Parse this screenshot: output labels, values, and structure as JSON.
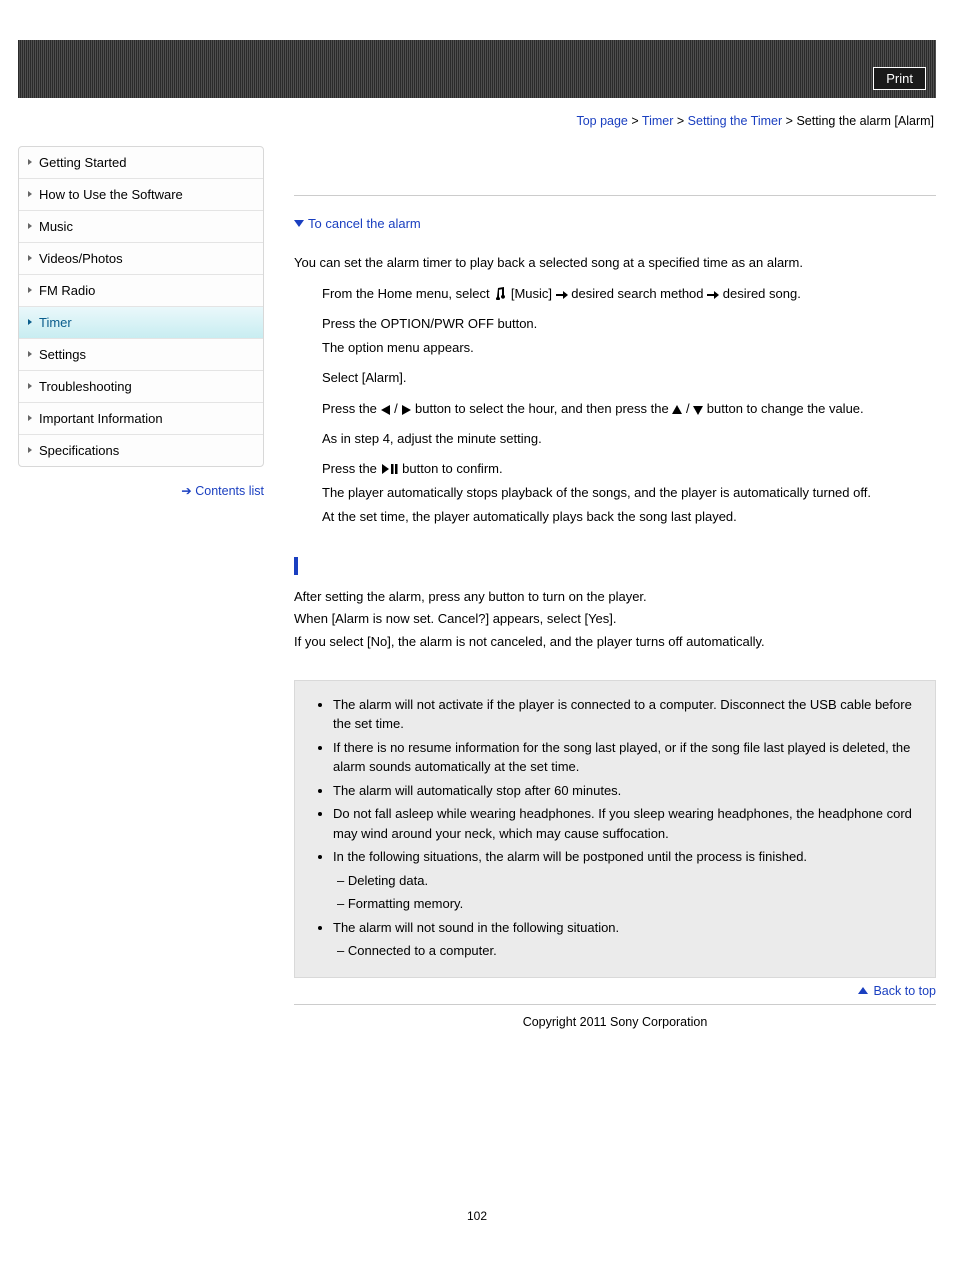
{
  "header": {
    "print_label": "Print"
  },
  "breadcrumbs": {
    "items": [
      "Top page",
      "Timer",
      "Setting the Timer"
    ],
    "current": "Setting the alarm [Alarm]",
    "sep": " > "
  },
  "sidebar": {
    "items": [
      {
        "label": "Getting Started",
        "active": false
      },
      {
        "label": "How to Use the Software",
        "active": false
      },
      {
        "label": "Music",
        "active": false
      },
      {
        "label": "Videos/Photos",
        "active": false
      },
      {
        "label": "FM Radio",
        "active": false
      },
      {
        "label": "Timer",
        "active": true
      },
      {
        "label": "Settings",
        "active": false
      },
      {
        "label": "Troubleshooting",
        "active": false
      },
      {
        "label": "Important Information",
        "active": false
      },
      {
        "label": "Specifications",
        "active": false
      }
    ],
    "contents_list": "Contents list"
  },
  "main": {
    "jump": "To cancel the alarm",
    "intro": "You can set the alarm timer to play back a selected song at a specified time as an alarm.",
    "steps": {
      "s1a": "From the Home menu, select ",
      "s1b": "[Music] ",
      "s1c": " desired search method ",
      "s1d": " desired song.",
      "s2a": "Press the OPTION/PWR OFF button.",
      "s2b": "The option menu appears.",
      "s3": "Select [Alarm].",
      "s4a": "Press the ",
      "s4b": " / ",
      "s4c": " button to select the hour, and then press the ",
      "s4d": " / ",
      "s4e": " button to change the value.",
      "s5": "As in step 4, adjust the minute setting.",
      "s6a": "Press the ",
      "s6b": " button to confirm.",
      "s6c": "The player automatically stops playback of the songs, and the player is automatically turned off.",
      "s6d": "At the set time, the player automatically plays back the song last played."
    },
    "cancel": {
      "l1": "After setting the alarm, press any button to turn on the player.",
      "l2": "When [Alarm is now set. Cancel?] appears, select [Yes].",
      "l3": "If you select [No], the alarm is not canceled, and the player turns off automatically."
    },
    "notes": {
      "n1": "The alarm will not activate if the player is connected to a computer. Disconnect the USB cable before the set time.",
      "n2": "If there is no resume information for the song last played, or if the song file last played is deleted, the alarm sounds automatically at the set time.",
      "n3": "The alarm will automatically stop after 60 minutes.",
      "n4": "Do not fall asleep while wearing headphones. If you sleep wearing headphones, the headphone cord may wind around your neck, which may cause suffocation.",
      "n5": "In the following situations, the alarm will be postponed until the process is finished.",
      "n5a": "Deleting data.",
      "n5b": "Formatting memory.",
      "n6": "The alarm will not sound in the following situation.",
      "n6a": "Connected to a computer."
    },
    "backtop": "Back to top"
  },
  "footer": {
    "copyright": "Copyright 2011 Sony Corporation"
  },
  "pagenum": "102"
}
